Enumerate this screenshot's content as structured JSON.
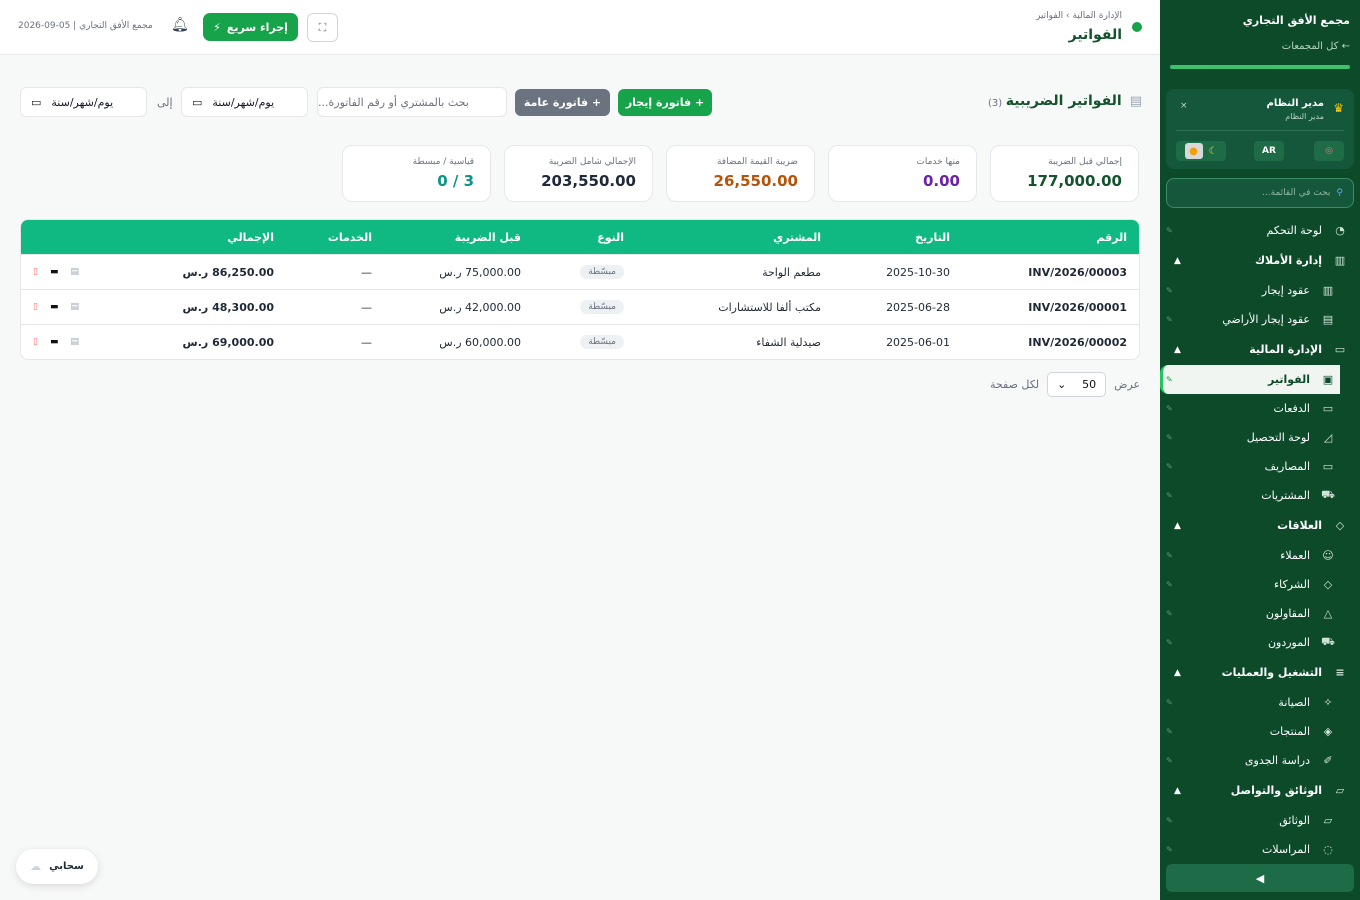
{
  "sidebar": {
    "company": "مجمع الأفق التجاري",
    "back_link": "← كل المجمعات",
    "user_name": "مدير النظام",
    "user_role": "مدير النظام",
    "lang": "AR",
    "search_placeholder": "بحث في القائمة...",
    "items": [
      {
        "label": "لوحة التحكم",
        "icon": "dashboard-icon"
      },
      {
        "label": "إدارة الأملاك",
        "icon": "building-icon",
        "section": true
      },
      {
        "label": "عقود إيجار",
        "icon": "building-icon"
      },
      {
        "label": "عقود إيجار الأراضي",
        "icon": "land-icon"
      },
      {
        "label": "الإدارة المالية",
        "icon": "finance-icon",
        "section": true
      },
      {
        "label": "الفواتير",
        "icon": "invoice-icon",
        "active": true
      },
      {
        "label": "الدفعات",
        "icon": "payments-icon"
      },
      {
        "label": "لوحة التحصيل",
        "icon": "chart-icon"
      },
      {
        "label": "المصاريف",
        "icon": "expenses-icon"
      },
      {
        "label": "المشتريات",
        "icon": "cart-icon"
      },
      {
        "label": "العلاقات",
        "icon": "handshake-icon",
        "section": true
      },
      {
        "label": "العملاء",
        "icon": "users-icon"
      },
      {
        "label": "الشركاء",
        "icon": "handshake-icon"
      },
      {
        "label": "المقاولون",
        "icon": "contractor-icon"
      },
      {
        "label": "الموردون",
        "icon": "truck-icon"
      },
      {
        "label": "التشغيل والعمليات",
        "icon": "sliders-icon",
        "section": true
      },
      {
        "label": "الصيانة",
        "icon": "wrench-icon"
      },
      {
        "label": "المنتجات",
        "icon": "tag-icon"
      },
      {
        "label": "دراسة الجدوى",
        "icon": "pencil-icon"
      },
      {
        "label": "الوثائق والتواصل",
        "icon": "folder-icon",
        "section": true
      },
      {
        "label": "الوثائق",
        "icon": "folder-icon"
      },
      {
        "label": "المراسلات",
        "icon": "chat-icon"
      }
    ]
  },
  "header": {
    "breadcrumb": "الإدارة المالية › الفواتير",
    "title": "الفواتير",
    "meta": "2026-09-05 | مجمع الأفق التجاري",
    "quick_action": "إجراء سريع"
  },
  "toolbar": {
    "page_title": "الفواتير الضريبية",
    "count": "(3)",
    "rent_invoice_btn": "+ فاتورة إيجار",
    "general_invoice_btn": "+ فاتورة عامة",
    "search_placeholder": "بحث بالمشتري أو رقم الفاتورة...",
    "date_from": "يوم/شهر/سنة",
    "date_to": "يوم/شهر/سنة",
    "to_label": "إلى"
  },
  "stats": [
    {
      "label": "إجمالي قبل الضريبة",
      "value": "177,000.00",
      "color": "#14532d"
    },
    {
      "label": "منها خدمات",
      "value": "0.00",
      "color": "#6b21a8"
    },
    {
      "label": "ضريبة القيمة المضافة",
      "value": "26,550.00",
      "color": "#b45309"
    },
    {
      "label": "الإجمالي شامل الضريبة",
      "value": "203,550.00",
      "color": "#1f2937"
    },
    {
      "label": "قياسية / مبسطة",
      "value": "3 / 0",
      "color": "#0d9488"
    }
  ],
  "table": {
    "headers": {
      "number": "الرقم",
      "date": "التاريخ",
      "buyer": "المشتري",
      "type": "النوع",
      "pre_tax": "قبل الضريبة",
      "services": "الخدمات",
      "total": "الإجمالي"
    },
    "rows": [
      {
        "number": "INV/2026/00003",
        "date": "2025-10-30",
        "buyer": "مطعم الواحة",
        "type": "مبسّطة",
        "pre_tax": "75,000.00 ر.س",
        "services": "—",
        "total": "86,250.00 ر.س"
      },
      {
        "number": "INV/2026/00001",
        "date": "2025-06-28",
        "buyer": "مكتب ألفا للاستشارات",
        "type": "مبسّطة",
        "pre_tax": "42,000.00 ر.س",
        "services": "—",
        "total": "48,300.00 ر.س"
      },
      {
        "number": "INV/2026/00002",
        "date": "2025-06-01",
        "buyer": "صيدلية الشفاء",
        "type": "مبسّطة",
        "pre_tax": "60,000.00 ر.س",
        "services": "—",
        "total": "69,000.00 ر.س"
      }
    ]
  },
  "pager": {
    "show_label": "عرض",
    "page_size": "50",
    "per_page_label": "لكل صفحة"
  },
  "cloud_chip": "سحابي"
}
